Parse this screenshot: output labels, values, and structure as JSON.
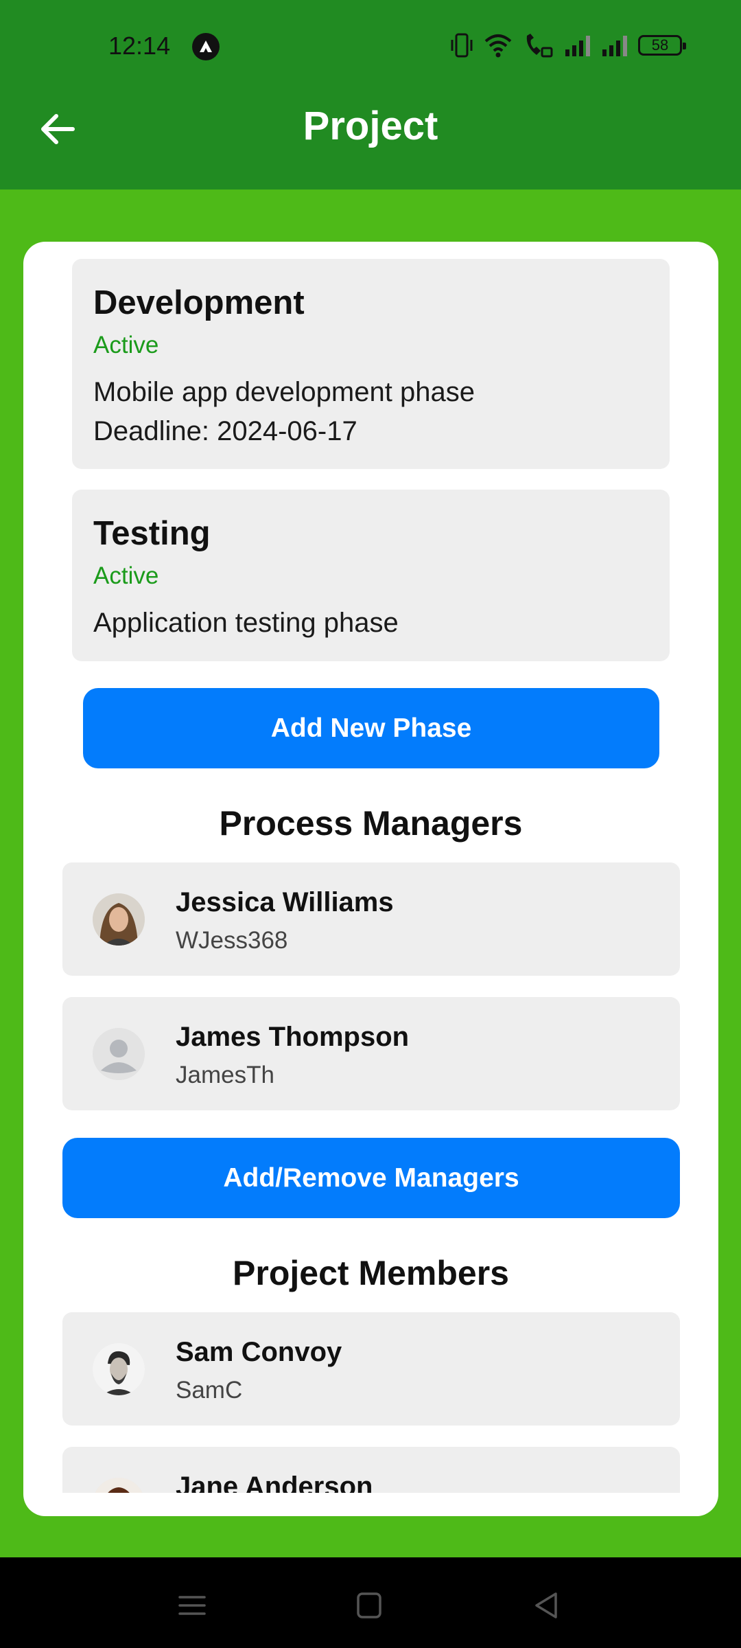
{
  "status_bar": {
    "time": "12:14",
    "battery": "58"
  },
  "app_bar": {
    "title": "Project"
  },
  "phases": [
    {
      "name": "Development",
      "status": "Active",
      "description": "Mobile app development phase",
      "deadline": "Deadline: 2024-06-17"
    },
    {
      "name": "Testing",
      "status": "Active",
      "description": "Application testing phase"
    }
  ],
  "add_phase_label": "Add New Phase",
  "managers": {
    "title": "Process Managers",
    "people": [
      {
        "name": "Jessica Williams",
        "handle": "WJess368"
      },
      {
        "name": "James Thompson",
        "handle": "JamesTh"
      }
    ],
    "button_label": "Add/Remove Managers"
  },
  "members": {
    "title": "Project Members",
    "people": [
      {
        "name": "Sam Convoy",
        "handle": "SamC"
      },
      {
        "name": "Jane Anderson",
        "handle": ""
      }
    ]
  },
  "colors": {
    "app_bar": "#218b22",
    "background": "#4eba18",
    "accent_button": "#037cfc",
    "active_status": "#1b9b1b"
  }
}
